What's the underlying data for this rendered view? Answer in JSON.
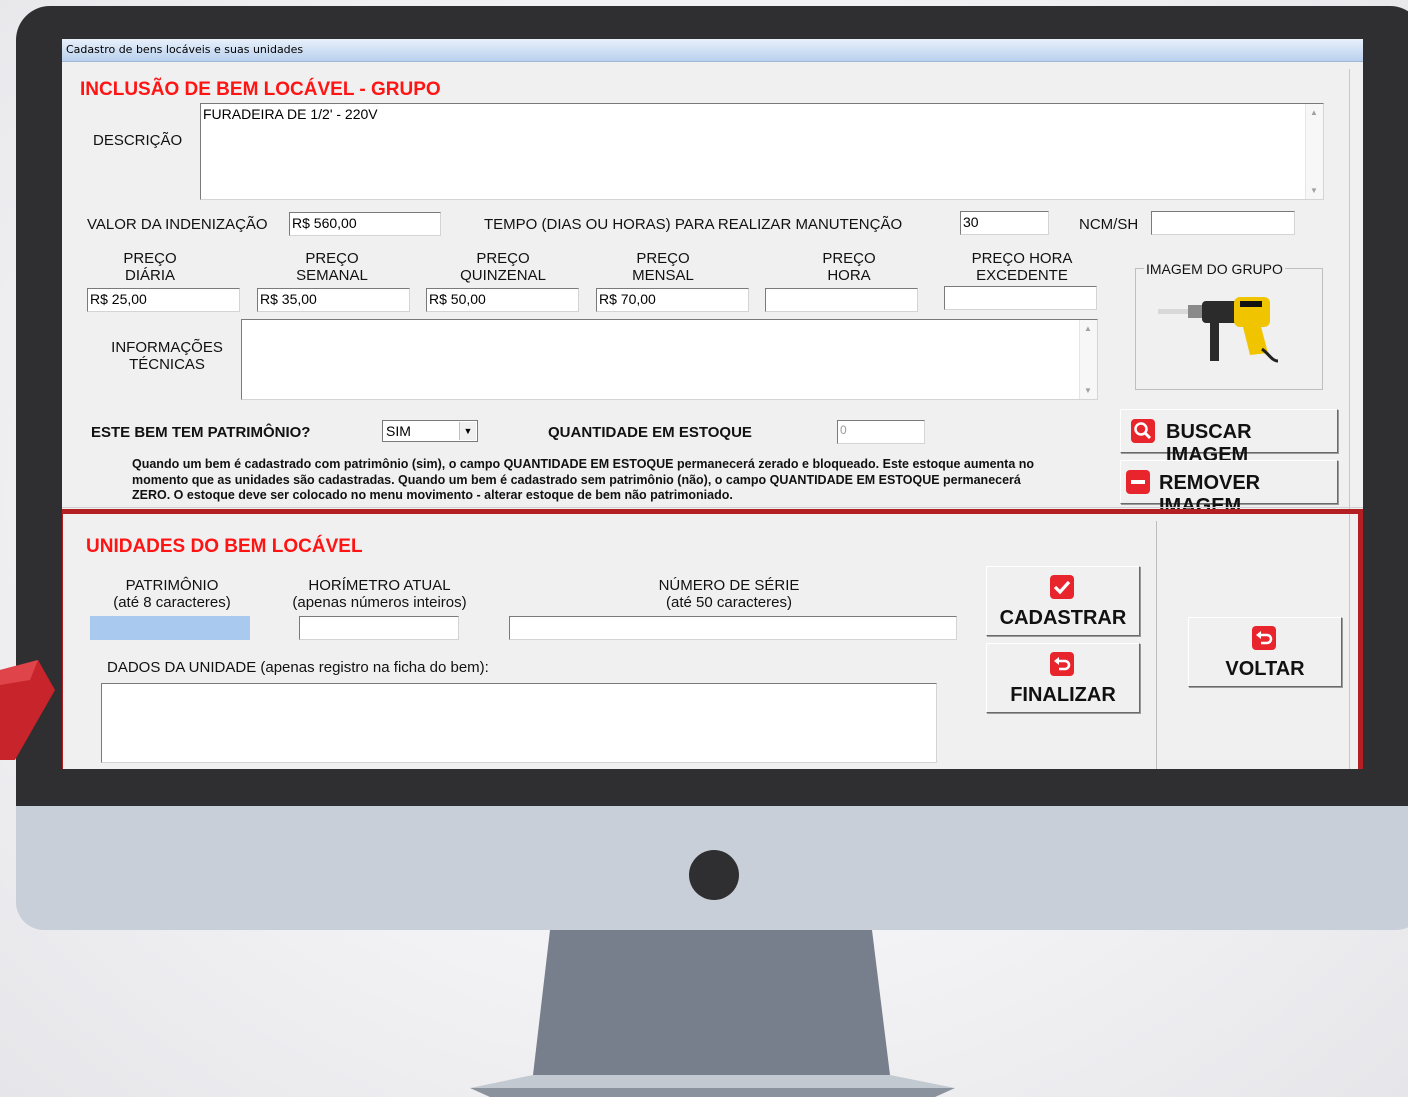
{
  "window": {
    "title": "Cadastro de bens locáveis e suas unidades"
  },
  "group_section": {
    "heading": "INCLUSÃO DE BEM LOCÁVEL - GRUPO",
    "descricao": {
      "label": "DESCRIÇÃO",
      "value": "FURADEIRA DE 1/2' - 220V"
    },
    "valor_indenizacao": {
      "label": "VALOR DA INDENIZAÇÃO",
      "value": "R$ 560,00"
    },
    "tempo_manutencao": {
      "label": "TEMPO (DIAS OU HORAS) PARA REALIZAR MANUTENÇÃO",
      "value": "30"
    },
    "ncm_sh": {
      "label": "NCM/SH",
      "value": ""
    },
    "precos": [
      {
        "line1": "PREÇO",
        "line2": "DIÁRIA",
        "value": "R$ 25,00"
      },
      {
        "line1": "PREÇO",
        "line2": "SEMANAL",
        "value": "R$ 35,00"
      },
      {
        "line1": "PREÇO",
        "line2": "QUINZENAL",
        "value": "R$ 50,00"
      },
      {
        "line1": "PREÇO",
        "line2": "MENSAL",
        "value": "R$ 70,00"
      },
      {
        "line1": "PREÇO",
        "line2": "HORA",
        "value": ""
      },
      {
        "line1": "PREÇO HORA",
        "line2": "EXCEDENTE",
        "value": ""
      }
    ],
    "informacoes_tecnicas": {
      "line1": "INFORMAÇÕES",
      "line2": "TÉCNICAS",
      "value": ""
    },
    "imagem_grupo": {
      "label": "IMAGEM DO GRUPO",
      "icon": "drill-image"
    },
    "buscar_imagem": {
      "label": "BUSCAR IMAGEM",
      "icon": "search-icon"
    },
    "remover_imagem": {
      "label": "REMOVER IMAGEM",
      "icon": "minus-icon"
    },
    "patrimonio_question": {
      "label": "ESTE BEM TEM PATRIMÔNIO?",
      "selected": "SIM"
    },
    "quantidade_estoque": {
      "label": "QUANTIDADE EM ESTOQUE",
      "value": "0"
    },
    "note": "Quando um bem é cadastrado com patrimônio (sim), o campo QUANTIDADE EM ESTOQUE permanecerá zerado e bloqueado. Este estoque aumenta no momento que as unidades são cadastradas. Quando um bem é cadastrado sem patrimônio (não), o campo QUANTIDADE EM ESTOQUE permanecerá ZERO. O estoque deve ser colocado no menu movimento - alterar estoque de bem não patrimoniado."
  },
  "units_section": {
    "heading": "UNIDADES DO BEM LOCÁVEL",
    "patrimonio": {
      "label": "PATRIMÔNIO",
      "hint": "(até 8 caracteres)",
      "value": ""
    },
    "horimetro": {
      "label": "HORÍMETRO ATUAL",
      "hint": "(apenas números inteiros)",
      "value": ""
    },
    "numero_serie": {
      "label": "NÚMERO DE SÉRIE",
      "hint": "(até 50 caracteres)",
      "value": ""
    },
    "dados_unidade": {
      "label": "DADOS DA UNIDADE (apenas registro na ficha do bem):",
      "value": ""
    },
    "cadastrar": {
      "label": "CADASTRAR",
      "icon": "check-icon"
    },
    "finalizar": {
      "label": "FINALIZAR",
      "icon": "return-icon"
    },
    "voltar": {
      "label": "VOLTAR",
      "icon": "return-icon"
    }
  },
  "colors": {
    "heading_red": "#ff1414",
    "highlight_frame": "#b41f24",
    "icon_red": "#e8252c",
    "monitor_bezel": "#2f2f31",
    "monitor_chin": "#c8cfd8"
  }
}
